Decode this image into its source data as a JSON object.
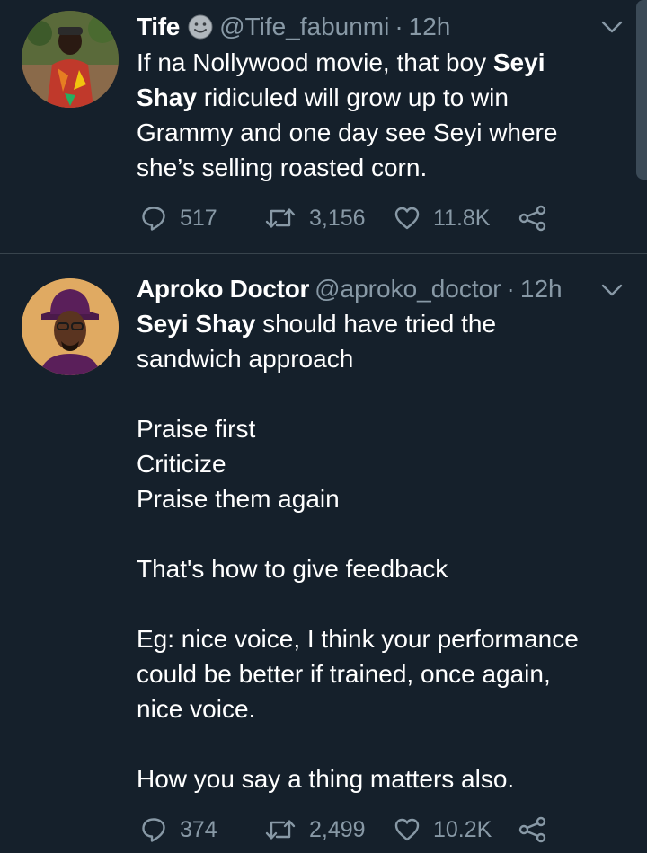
{
  "tweets": [
    {
      "name": "Tife",
      "handle": "@Tife_fabunmi",
      "dot": "·",
      "time": "12h",
      "lines": [
        [
          {
            "t": "If na Nollywood movie, that boy "
          },
          {
            "t": "Seyi",
            "b": true
          }
        ],
        [
          {
            "t": "Shay",
            "b": true
          },
          {
            "t": " ridiculed will grow up to win"
          }
        ],
        [
          {
            "t": "Grammy and one day see Seyi where"
          }
        ],
        [
          {
            "t": "she’s selling roasted corn."
          }
        ]
      ],
      "replies": "517",
      "retweets": "3,156",
      "likes": "11.8K"
    },
    {
      "name": "Aproko Doctor",
      "handle": "@aproko_doctor",
      "dot": "·",
      "time": "12h",
      "lines": [
        [
          {
            "t": "Seyi Shay",
            "b": true
          },
          {
            "t": " should have tried the"
          }
        ],
        [
          {
            "t": "sandwich approach"
          }
        ],
        [],
        [
          {
            "t": "Praise first"
          }
        ],
        [
          {
            "t": "Criticize"
          }
        ],
        [
          {
            "t": "Praise them again"
          }
        ],
        [],
        [
          {
            "t": "That's how to give feedback"
          }
        ],
        [],
        [
          {
            "t": "Eg: nice voice, I think your performance"
          }
        ],
        [
          {
            "t": "could be better if trained, once again,"
          }
        ],
        [
          {
            "t": "nice voice."
          }
        ],
        [],
        [
          {
            "t": "How you say a thing matters also."
          }
        ]
      ],
      "replies": "374",
      "retweets": "2,499",
      "likes": "10.2K"
    }
  ],
  "icons": {
    "reply": "reply-icon",
    "retweet": "retweet-icon",
    "like": "heart-icon",
    "share": "share-icon",
    "caret": "chevron-down-icon",
    "emoji": "smiley-emoji-icon"
  },
  "colors": {
    "background": "#15202b",
    "divider": "#38444d",
    "primary_text": "#ffffff",
    "secondary_text": "#8899a6"
  }
}
